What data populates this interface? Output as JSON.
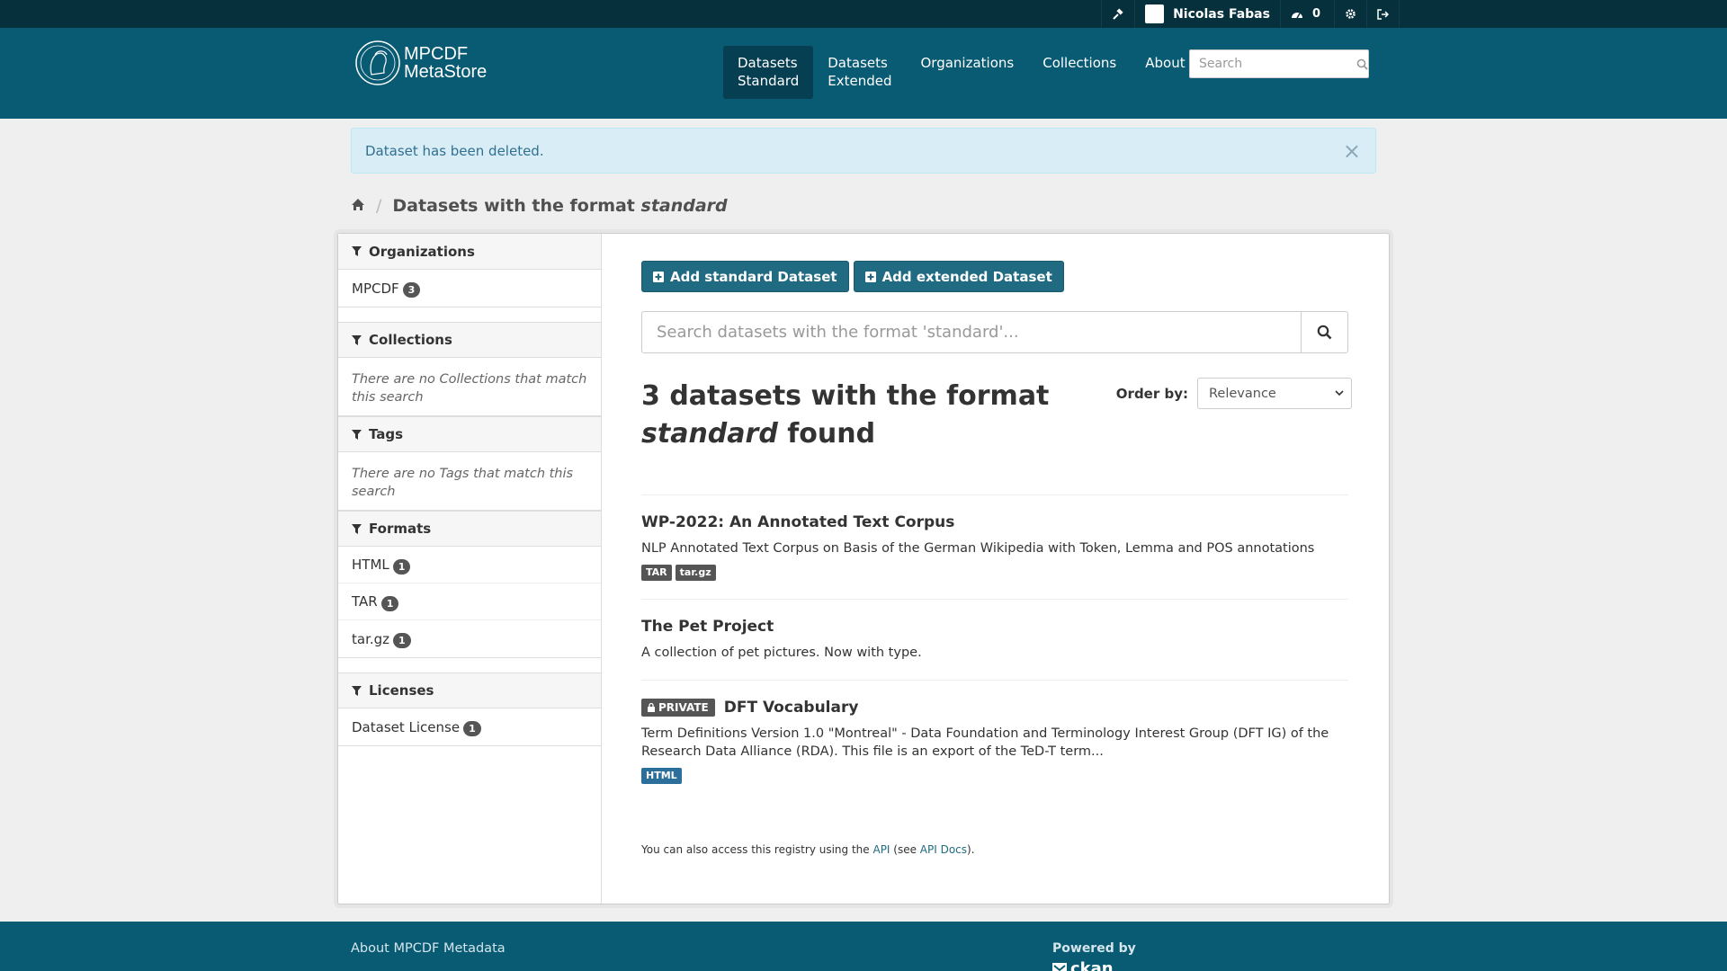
{
  "account": {
    "user_name": "Nicolas Fabas",
    "activity_count": "0"
  },
  "brand": {
    "line1": "MPCDF",
    "line2": "MetaStore"
  },
  "nav": {
    "items": [
      {
        "l1": "Datasets",
        "l2": "Standard"
      },
      {
        "l1": "Datasets",
        "l2": "Extended"
      },
      {
        "l1": "Organizations",
        "l2": ""
      },
      {
        "l1": "Collections",
        "l2": ""
      },
      {
        "l1": "About",
        "l2": ""
      }
    ],
    "search_placeholder": "Search"
  },
  "flash": {
    "message": "Dataset has been deleted.",
    "close": "×"
  },
  "breadcrumb": {
    "title_prefix": "Datasets with the format ",
    "title_format": "standard"
  },
  "sidebar": {
    "organizations": {
      "title": "Organizations",
      "items": [
        {
          "label": "MPCDF",
          "count": "3"
        }
      ]
    },
    "collections": {
      "title": "Collections",
      "empty": "There are no Collections that match this search"
    },
    "tags": {
      "title": "Tags",
      "empty": "There are no Tags that match this search"
    },
    "formats": {
      "title": "Formats",
      "items": [
        {
          "label": "HTML",
          "count": "1"
        },
        {
          "label": "TAR",
          "count": "1"
        },
        {
          "label": "tar.gz",
          "count": "1"
        }
      ]
    },
    "licenses": {
      "title": "Licenses",
      "items": [
        {
          "label": "Dataset License",
          "count": "1"
        }
      ]
    }
  },
  "main": {
    "add_standard": "Add standard Dataset",
    "add_extended": "Add extended Dataset",
    "search_placeholder": "Search datasets with the format 'standard'...",
    "results_count": "3 datasets with the format",
    "results_format": "standard",
    "results_suffix": " found",
    "order_label": "Order by:",
    "order_value": "Relevance"
  },
  "datasets": [
    {
      "title": "WP-2022: An Annotated Text Corpus",
      "notes": "NLP Annotated Text Corpus on Basis of the German Wikipedia with Token, Lemma and POS annotations",
      "formats": [
        "TAR",
        "tar.gz"
      ]
    },
    {
      "title": "The Pet Project",
      "notes": "A collection of pet pictures. Now with type."
    },
    {
      "private_label": "PRIVATE",
      "title": "DFT Vocabulary",
      "notes": "Term Definitions Version 1.0 \"Montreal\" - Data Foundation and Terminology Interest Group (DFT IG) of the Research Data Alliance (RDA). This file is an export of the TeD-T term...",
      "formats": [
        "HTML"
      ]
    }
  ],
  "api_note": {
    "prefix": "You can also access this registry using the ",
    "api": "API",
    "middle": " (see ",
    "docs": "API Docs",
    "suffix": ")."
  },
  "footer": {
    "about": "About MPCDF Metadata",
    "powered_by": "Powered by",
    "ckan": "ckan"
  },
  "colors": {
    "masthead": "#095a73",
    "account_bar": "#07303d",
    "primary_button": "#206b82",
    "label_grey": "#555555",
    "label_html": "#2d6f9b"
  }
}
